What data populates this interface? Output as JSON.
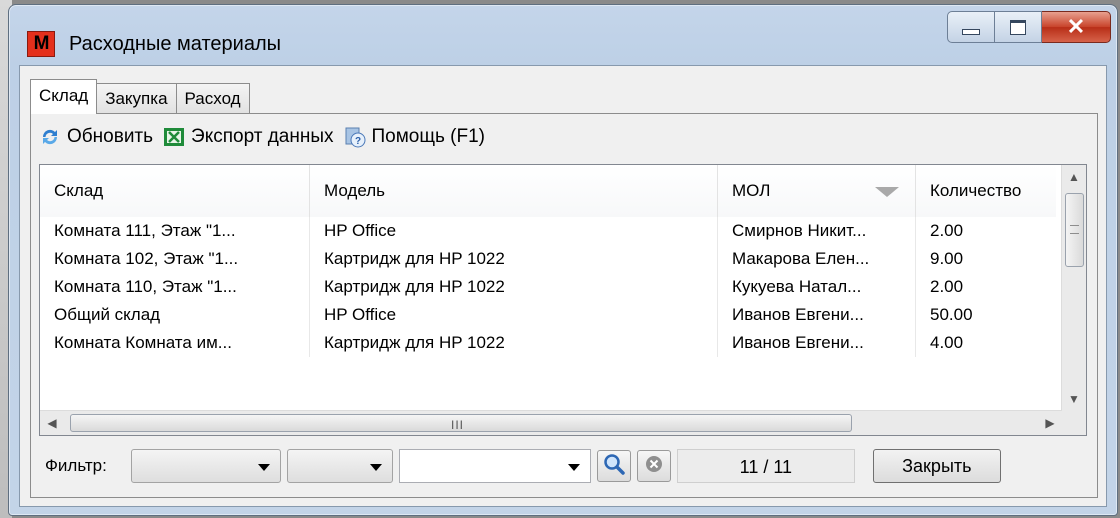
{
  "window": {
    "title": "Расходные материалы",
    "app_icon_text": "M"
  },
  "tabs": [
    {
      "label": "Склад"
    },
    {
      "label": "Закупка"
    },
    {
      "label": "Расход"
    }
  ],
  "toolbar": {
    "refresh_label": "Обновить",
    "export_label": "Экспорт данных",
    "help_label": "Помощь (F1)"
  },
  "grid": {
    "columns": [
      "Склад",
      "Модель",
      "МОЛ",
      "Количество"
    ],
    "rows": [
      [
        "Комната 111, Этаж \"1...",
        "HP Office",
        "Смирнов Никит...",
        "2.00"
      ],
      [
        "Комната 102, Этаж \"1...",
        "Картридж для HP 1022",
        "Макарова Елен...",
        "9.00"
      ],
      [
        "Комната 110, Этаж \"1...",
        "Картридж для HP 1022",
        "Кукуева Натал...",
        "2.00"
      ],
      [
        "Общий склад",
        "HP Office",
        "Иванов Евгени...",
        "50.00"
      ],
      [
        "Комната Комната им...",
        "Картридж для HP 1022",
        "Иванов Евгени...",
        "4.00"
      ]
    ],
    "sort_column": "МОЛ",
    "sort_direction": "descending"
  },
  "filter": {
    "label": "Фильтр:",
    "field1_value": "",
    "field2_value": "",
    "field3_value": "",
    "counter": "11 / 11"
  },
  "buttons": {
    "close_label": "Закрыть"
  }
}
